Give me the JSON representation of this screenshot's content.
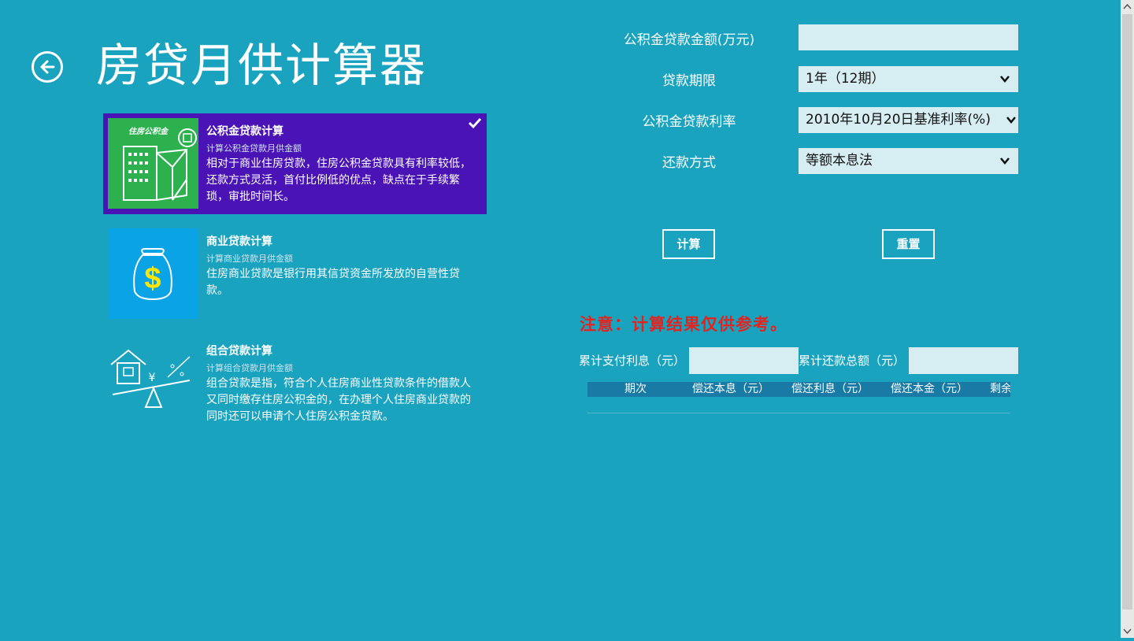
{
  "header": {
    "title": "房贷月供计算器"
  },
  "options": [
    {
      "title": "公积金贷款计算",
      "subtitle": "计算公积金贷款月供金额",
      "description": "相对于商业住房贷款，住房公积金贷款具有利率较低，还款方式灵活，首付比例低的优点，缺点在于手续繁琐，审批时间长。",
      "thumb_label": "住房公积金",
      "thumb_color": "#2db14f",
      "icon": "building-icon",
      "selected": true
    },
    {
      "title": "商业贷款计算",
      "subtitle": "计算商业贷款月供金额",
      "description": "住房商业贷款是银行用其信贷资金所发放的自营性贷款。",
      "thumb_color": "#0aa3e6",
      "icon": "money-bag-icon",
      "selected": false
    },
    {
      "title": "组合贷款计算",
      "subtitle": "计算组合贷款月供金额",
      "description": "组合贷款是指，符合个人住房商业性贷款条件的借款人又同时缴存住房公积金的，在办理个人住房商业贷款的同时还可以申请个人住房公积金贷款。",
      "icon": "scale-house-icon",
      "selected": false
    }
  ],
  "form": {
    "amount_label": "公积金贷款金额(万元)",
    "amount_value": "",
    "term_label": "贷款期限",
    "term_value": "1年（12期）",
    "rate_label": "公积金贷款利率",
    "rate_value": "2010年10月20日基准利率(%)",
    "method_label": "还款方式",
    "method_value": "等额本息法"
  },
  "buttons": {
    "calculate": "计算",
    "reset": "重置"
  },
  "notice": "注意：计算结果仅供参考。",
  "summary": {
    "interest_label": "累计支付利息（元）",
    "interest_value": "",
    "total_label": "累计还款总额（元）",
    "total_value": ""
  },
  "table": {
    "columns": [
      "期次",
      "偿还本息（元）",
      "偿还利息（元）",
      "偿还本金（元）",
      "剩余"
    ]
  },
  "colors": {
    "background": "#19a3bf",
    "selected_item": "#4a13b6",
    "notice": "#e4231f",
    "input_bg": "#d6edf2",
    "table_header": "#1a7aa6"
  }
}
